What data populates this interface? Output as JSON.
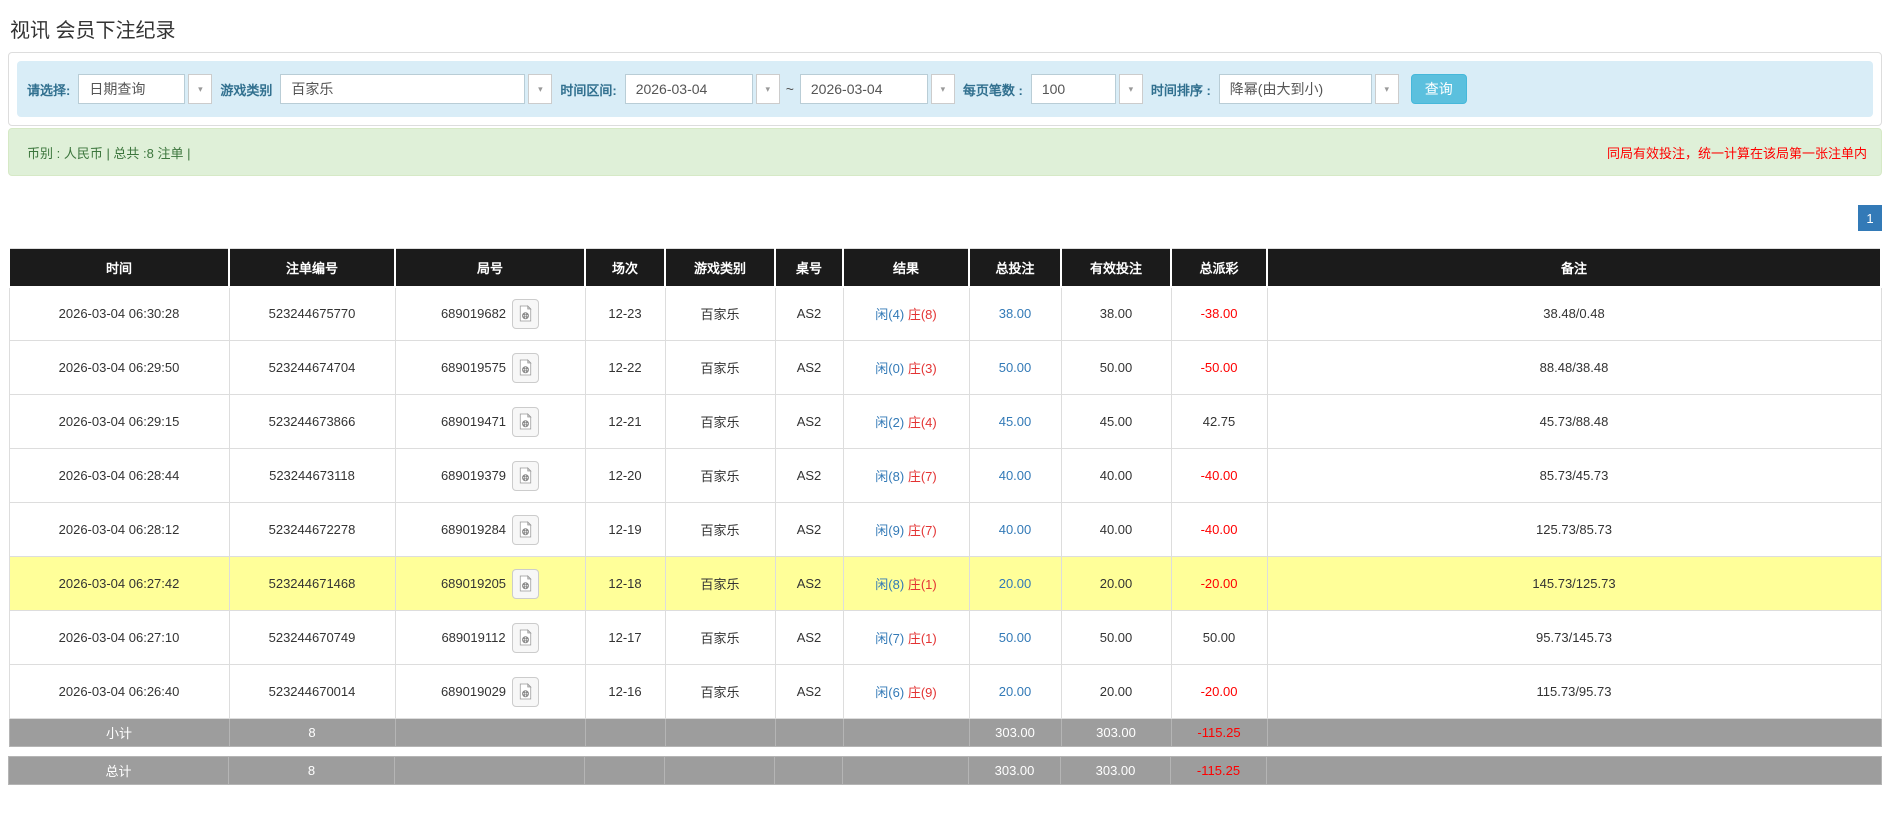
{
  "page": {
    "title": "视讯 会员下注纪录"
  },
  "filters": {
    "select_label": "请选择:",
    "select_value": "日期查询",
    "game_type_label": "游戏类别",
    "game_type_value": "百家乐",
    "time_range_label": "时间区间:",
    "date_from": "2026-03-04",
    "tilde": "~",
    "date_to": "2026-03-04",
    "page_size_label": "每页笔数 :",
    "page_size_value": "100",
    "sort_label": "时间排序 :",
    "sort_value": "降幂(由大到小)",
    "query_button": "查询"
  },
  "notice": {
    "left": "币别 : 人民币 | 总共 :8 注单 |",
    "right": "同局有效投注，统一计算在该局第一张注单内"
  },
  "pagination": {
    "current": "1"
  },
  "colors": {
    "accent_button": "#5bc0de",
    "link_blue": "#337ab7",
    "negative_red": "#ff0000",
    "banker_red": "#e33333",
    "highlight_yellow": "#ffff99",
    "header_black": "#1b1b1b",
    "summary_gray": "#9d9d9d",
    "notice_green_bg": "#dff0d8",
    "notice_green_text": "#3c763d",
    "filter_strip_blue": "#d9edf7"
  },
  "table": {
    "headers": [
      "时间",
      "注单编号",
      "局号",
      "场次",
      "游戏类别",
      "桌号",
      "结果",
      "总投注",
      "有效投注",
      "总派彩",
      "备注"
    ],
    "rows": [
      {
        "time": "2026-03-04 06:30:28",
        "bet_id": "523244675770",
        "round_id": "689019682",
        "session": "12-23",
        "game_type": "百家乐",
        "table_no": "AS2",
        "result_player": "闲(4)",
        "result_banker": "庄(8)",
        "bet_total": "38.00",
        "valid_bet": "38.00",
        "payout": "-38.00",
        "remark": "38.48/0.48",
        "highlighted": false
      },
      {
        "time": "2026-03-04 06:29:50",
        "bet_id": "523244674704",
        "round_id": "689019575",
        "session": "12-22",
        "game_type": "百家乐",
        "table_no": "AS2",
        "result_player": "闲(0)",
        "result_banker": "庄(3)",
        "bet_total": "50.00",
        "valid_bet": "50.00",
        "payout": "-50.00",
        "remark": "88.48/38.48",
        "highlighted": false
      },
      {
        "time": "2026-03-04 06:29:15",
        "bet_id": "523244673866",
        "round_id": "689019471",
        "session": "12-21",
        "game_type": "百家乐",
        "table_no": "AS2",
        "result_player": "闲(2)",
        "result_banker": "庄(4)",
        "bet_total": "45.00",
        "valid_bet": "45.00",
        "payout": "42.75",
        "remark": "45.73/88.48",
        "highlighted": false
      },
      {
        "time": "2026-03-04 06:28:44",
        "bet_id": "523244673118",
        "round_id": "689019379",
        "session": "12-20",
        "game_type": "百家乐",
        "table_no": "AS2",
        "result_player": "闲(8)",
        "result_banker": "庄(7)",
        "bet_total": "40.00",
        "valid_bet": "40.00",
        "payout": "-40.00",
        "remark": "85.73/45.73",
        "highlighted": false
      },
      {
        "time": "2026-03-04 06:28:12",
        "bet_id": "523244672278",
        "round_id": "689019284",
        "session": "12-19",
        "game_type": "百家乐",
        "table_no": "AS2",
        "result_player": "闲(9)",
        "result_banker": "庄(7)",
        "bet_total": "40.00",
        "valid_bet": "40.00",
        "payout": "-40.00",
        "remark": "125.73/85.73",
        "highlighted": false
      },
      {
        "time": "2026-03-04 06:27:42",
        "bet_id": "523244671468",
        "round_id": "689019205",
        "session": "12-18",
        "game_type": "百家乐",
        "table_no": "AS2",
        "result_player": "闲(8)",
        "result_banker": "庄(1)",
        "bet_total": "20.00",
        "valid_bet": "20.00",
        "payout": "-20.00",
        "remark": "145.73/125.73",
        "highlighted": true
      },
      {
        "time": "2026-03-04 06:27:10",
        "bet_id": "523244670749",
        "round_id": "689019112",
        "session": "12-17",
        "game_type": "百家乐",
        "table_no": "AS2",
        "result_player": "闲(7)",
        "result_banker": "庄(1)",
        "bet_total": "50.00",
        "valid_bet": "50.00",
        "payout": "50.00",
        "remark": "95.73/145.73",
        "highlighted": false
      },
      {
        "time": "2026-03-04 06:26:40",
        "bet_id": "523244670014",
        "round_id": "689019029",
        "session": "12-16",
        "game_type": "百家乐",
        "table_no": "AS2",
        "result_player": "闲(6)",
        "result_banker": "庄(9)",
        "bet_total": "20.00",
        "valid_bet": "20.00",
        "payout": "-20.00",
        "remark": "115.73/95.73",
        "highlighted": false
      }
    ],
    "subtotal": {
      "label": "小计",
      "count": "8",
      "bet_total": "303.00",
      "valid_bet": "303.00",
      "payout": "-115.25"
    },
    "total": {
      "label": "总计",
      "count": "8",
      "bet_total": "303.00",
      "valid_bet": "303.00",
      "payout": "-115.25"
    }
  }
}
